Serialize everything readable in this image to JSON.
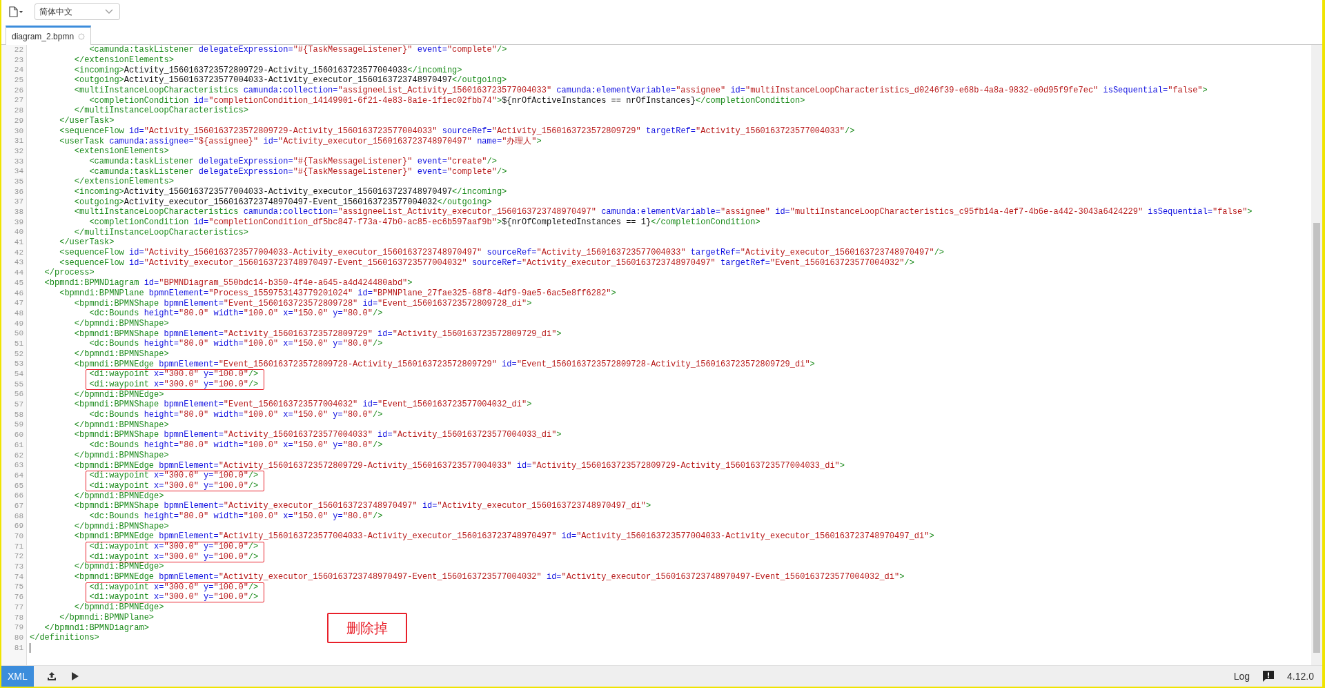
{
  "toolbar": {
    "language_select": {
      "value": "简体中文"
    }
  },
  "tabs": [
    {
      "label": "diagram_2.bpmn",
      "selected": true
    }
  ],
  "editor": {
    "lines": [
      {
        "number": "22",
        "marked": false,
        "cursor": false,
        "tokens": [
          {
            "kind": "tag",
            "text": "            <camunda:taskListener "
          },
          {
            "kind": "attr",
            "text": "delegateExpression="
          },
          {
            "kind": "value",
            "text": "\"#{TaskMessageListener}\""
          },
          {
            "kind": "attr",
            "text": " event="
          },
          {
            "kind": "value",
            "text": "\"complete\""
          },
          {
            "kind": "tag",
            "text": "/>"
          }
        ]
      },
      {
        "number": "23",
        "marked": false,
        "cursor": false,
        "tokens": [
          {
            "kind": "tag",
            "text": "         </extensionElements>"
          }
        ]
      },
      {
        "number": "24",
        "marked": false,
        "cursor": false,
        "tokens": [
          {
            "kind": "tag",
            "text": "         <incoming>"
          },
          {
            "kind": "text",
            "text": "Activity_1560163723572809729-Activity_1560163723577004033"
          },
          {
            "kind": "tag",
            "text": "</incoming>"
          }
        ]
      },
      {
        "number": "25",
        "marked": false,
        "cursor": false,
        "tokens": [
          {
            "kind": "tag",
            "text": "         <outgoing>"
          },
          {
            "kind": "text",
            "text": "Activity_1560163723577004033-Activity_executor_1560163723748970497"
          },
          {
            "kind": "tag",
            "text": "</outgoing>"
          }
        ]
      },
      {
        "number": "26",
        "marked": false,
        "cursor": false,
        "tokens": [
          {
            "kind": "tag",
            "text": "         <multiInstanceLoopCharacteristics "
          },
          {
            "kind": "attr",
            "text": "camunda:collection="
          },
          {
            "kind": "value",
            "text": "\"assigneeList_Activity_1560163723577004033\""
          },
          {
            "kind": "attr",
            "text": " camunda:elementVariable="
          },
          {
            "kind": "value",
            "text": "\"assignee\""
          },
          {
            "kind": "attr",
            "text": " id="
          },
          {
            "kind": "value",
            "text": "\"multiInstanceLoopCharacteristics_d0246f39-e68b-4a8a-9832-e0d95f9fe7ec\""
          },
          {
            "kind": "attr",
            "text": " isSequential="
          },
          {
            "kind": "value",
            "text": "\"false\""
          },
          {
            "kind": "tag",
            "text": ">"
          }
        ]
      },
      {
        "number": "27",
        "marked": false,
        "cursor": false,
        "tokens": [
          {
            "kind": "tag",
            "text": "            <completionCondition "
          },
          {
            "kind": "attr",
            "text": "id="
          },
          {
            "kind": "value",
            "text": "\"completionCondition_14149901-6f21-4e83-8a1e-1f1ec02fbb74\""
          },
          {
            "kind": "tag",
            "text": ">"
          },
          {
            "kind": "text",
            "text": "${nrOfActiveInstances == nrOfInstances}"
          },
          {
            "kind": "tag",
            "text": "</completionCondition>"
          }
        ]
      },
      {
        "number": "28",
        "marked": false,
        "cursor": false,
        "tokens": [
          {
            "kind": "tag",
            "text": "         </multiInstanceLoopCharacteristics>"
          }
        ]
      },
      {
        "number": "29",
        "marked": false,
        "cursor": false,
        "tokens": [
          {
            "kind": "tag",
            "text": "      </userTask>"
          }
        ]
      },
      {
        "number": "30",
        "marked": false,
        "cursor": false,
        "tokens": [
          {
            "kind": "tag",
            "text": "      <sequenceFlow "
          },
          {
            "kind": "attr",
            "text": "id="
          },
          {
            "kind": "value",
            "text": "\"Activity_1560163723572809729-Activity_1560163723577004033\""
          },
          {
            "kind": "attr",
            "text": " sourceRef="
          },
          {
            "kind": "value",
            "text": "\"Activity_1560163723572809729\""
          },
          {
            "kind": "attr",
            "text": " targetRef="
          },
          {
            "kind": "value",
            "text": "\"Activity_1560163723577004033\""
          },
          {
            "kind": "tag",
            "text": "/>"
          }
        ]
      },
      {
        "number": "31",
        "marked": false,
        "cursor": false,
        "tokens": [
          {
            "kind": "tag",
            "text": "      <userTask "
          },
          {
            "kind": "attr",
            "text": "camunda:assignee="
          },
          {
            "kind": "value",
            "text": "\"${assignee}\""
          },
          {
            "kind": "attr",
            "text": " id="
          },
          {
            "kind": "value",
            "text": "\"Activity_executor_1560163723748970497\""
          },
          {
            "kind": "attr",
            "text": " name="
          },
          {
            "kind": "value",
            "text": "\"办理人\""
          },
          {
            "kind": "tag",
            "text": ">"
          }
        ]
      },
      {
        "number": "32",
        "marked": false,
        "cursor": false,
        "tokens": [
          {
            "kind": "tag",
            "text": "         <extensionElements>"
          }
        ]
      },
      {
        "number": "33",
        "marked": false,
        "cursor": false,
        "tokens": [
          {
            "kind": "tag",
            "text": "            <camunda:taskListener "
          },
          {
            "kind": "attr",
            "text": "delegateExpression="
          },
          {
            "kind": "value",
            "text": "\"#{TaskMessageListener}\""
          },
          {
            "kind": "attr",
            "text": " event="
          },
          {
            "kind": "value",
            "text": "\"create\""
          },
          {
            "kind": "tag",
            "text": "/>"
          }
        ]
      },
      {
        "number": "34",
        "marked": false,
        "cursor": false,
        "tokens": [
          {
            "kind": "tag",
            "text": "            <camunda:taskListener "
          },
          {
            "kind": "attr",
            "text": "delegateExpression="
          },
          {
            "kind": "value",
            "text": "\"#{TaskMessageListener}\""
          },
          {
            "kind": "attr",
            "text": " event="
          },
          {
            "kind": "value",
            "text": "\"complete\""
          },
          {
            "kind": "tag",
            "text": "/>"
          }
        ]
      },
      {
        "number": "35",
        "marked": false,
        "cursor": false,
        "tokens": [
          {
            "kind": "tag",
            "text": "         </extensionElements>"
          }
        ]
      },
      {
        "number": "36",
        "marked": false,
        "cursor": false,
        "tokens": [
          {
            "kind": "tag",
            "text": "         <incoming>"
          },
          {
            "kind": "text",
            "text": "Activity_1560163723577004033-Activity_executor_1560163723748970497"
          },
          {
            "kind": "tag",
            "text": "</incoming>"
          }
        ]
      },
      {
        "number": "37",
        "marked": false,
        "cursor": false,
        "tokens": [
          {
            "kind": "tag",
            "text": "         <outgoing>"
          },
          {
            "kind": "text",
            "text": "Activity_executor_1560163723748970497-Event_1560163723577004032"
          },
          {
            "kind": "tag",
            "text": "</outgoing>"
          }
        ]
      },
      {
        "number": "38",
        "marked": false,
        "cursor": false,
        "tokens": [
          {
            "kind": "tag",
            "text": "         <multiInstanceLoopCharacteristics "
          },
          {
            "kind": "attr",
            "text": "camunda:collection="
          },
          {
            "kind": "value",
            "text": "\"assigneeList_Activity_executor_1560163723748970497\""
          },
          {
            "kind": "attr",
            "text": " camunda:elementVariable="
          },
          {
            "kind": "value",
            "text": "\"assignee\""
          },
          {
            "kind": "attr",
            "text": " id="
          },
          {
            "kind": "value",
            "text": "\"multiInstanceLoopCharacteristics_c95fb14a-4ef7-4b6e-a442-3043a6424229\""
          },
          {
            "kind": "attr",
            "text": " isSequential="
          },
          {
            "kind": "value",
            "text": "\"false\""
          },
          {
            "kind": "tag",
            "text": ">"
          }
        ]
      },
      {
        "number": "39",
        "marked": false,
        "cursor": false,
        "tokens": [
          {
            "kind": "tag",
            "text": "            <completionCondition "
          },
          {
            "kind": "attr",
            "text": "id="
          },
          {
            "kind": "value",
            "text": "\"completionCondition_df5bc847-f73a-47b0-ac85-ec6b597aaf9b\""
          },
          {
            "kind": "tag",
            "text": ">"
          },
          {
            "kind": "text",
            "text": "${nrOfCompletedInstances == 1}"
          },
          {
            "kind": "tag",
            "text": "</completionCondition>"
          }
        ]
      },
      {
        "number": "40",
        "marked": false,
        "cursor": false,
        "tokens": [
          {
            "kind": "tag",
            "text": "         </multiInstanceLoopCharacteristics>"
          }
        ]
      },
      {
        "number": "41",
        "marked": false,
        "cursor": false,
        "tokens": [
          {
            "kind": "tag",
            "text": "      </userTask>"
          }
        ]
      },
      {
        "number": "42",
        "marked": false,
        "cursor": false,
        "tokens": [
          {
            "kind": "tag",
            "text": "      <sequenceFlow "
          },
          {
            "kind": "attr",
            "text": "id="
          },
          {
            "kind": "value",
            "text": "\"Activity_1560163723577004033-Activity_executor_1560163723748970497\""
          },
          {
            "kind": "attr",
            "text": " sourceRef="
          },
          {
            "kind": "value",
            "text": "\"Activity_1560163723577004033\""
          },
          {
            "kind": "attr",
            "text": " targetRef="
          },
          {
            "kind": "value",
            "text": "\"Activity_executor_1560163723748970497\""
          },
          {
            "kind": "tag",
            "text": "/>"
          }
        ]
      },
      {
        "number": "43",
        "marked": false,
        "cursor": false,
        "tokens": [
          {
            "kind": "tag",
            "text": "      <sequenceFlow "
          },
          {
            "kind": "attr",
            "text": "id="
          },
          {
            "kind": "value",
            "text": "\"Activity_executor_1560163723748970497-Event_1560163723577004032\""
          },
          {
            "kind": "attr",
            "text": " sourceRef="
          },
          {
            "kind": "value",
            "text": "\"Activity_executor_1560163723748970497\""
          },
          {
            "kind": "attr",
            "text": " targetRef="
          },
          {
            "kind": "value",
            "text": "\"Event_1560163723577004032\""
          },
          {
            "kind": "tag",
            "text": "/>"
          }
        ]
      },
      {
        "number": "44",
        "marked": false,
        "cursor": false,
        "tokens": [
          {
            "kind": "tag",
            "text": "   </process>"
          }
        ]
      },
      {
        "number": "45",
        "marked": false,
        "cursor": false,
        "tokens": [
          {
            "kind": "tag",
            "text": "   <bpmndi:BPMNDiagram "
          },
          {
            "kind": "attr",
            "text": "id="
          },
          {
            "kind": "value",
            "text": "\"BPMNDiagram_550bdc14-b350-4f4e-a645-a4d424480abd\""
          },
          {
            "kind": "tag",
            "text": ">"
          }
        ]
      },
      {
        "number": "46",
        "marked": false,
        "cursor": false,
        "tokens": [
          {
            "kind": "tag",
            "text": "      <bpmndi:BPMNPlane "
          },
          {
            "kind": "attr",
            "text": "bpmnElement="
          },
          {
            "kind": "value",
            "text": "\"Process_1559753143779201024\""
          },
          {
            "kind": "attr",
            "text": " id="
          },
          {
            "kind": "value",
            "text": "\"BPMNPlane_27fae325-68f8-4df9-9ae5-6ac5e8ff6282\""
          },
          {
            "kind": "tag",
            "text": ">"
          }
        ]
      },
      {
        "number": "47",
        "marked": false,
        "cursor": false,
        "tokens": [
          {
            "kind": "tag",
            "text": "         <bpmndi:BPMNShape "
          },
          {
            "kind": "attr",
            "text": "bpmnElement="
          },
          {
            "kind": "value",
            "text": "\"Event_1560163723572809728\""
          },
          {
            "kind": "attr",
            "text": " id="
          },
          {
            "kind": "value",
            "text": "\"Event_1560163723572809728_di\""
          },
          {
            "kind": "tag",
            "text": ">"
          }
        ]
      },
      {
        "number": "48",
        "marked": false,
        "cursor": false,
        "tokens": [
          {
            "kind": "tag",
            "text": "            <dc:Bounds "
          },
          {
            "kind": "attr",
            "text": "height="
          },
          {
            "kind": "value",
            "text": "\"80.0\""
          },
          {
            "kind": "attr",
            "text": " width="
          },
          {
            "kind": "value",
            "text": "\"100.0\""
          },
          {
            "kind": "attr",
            "text": " x="
          },
          {
            "kind": "value",
            "text": "\"150.0\""
          },
          {
            "kind": "attr",
            "text": " y="
          },
          {
            "kind": "value",
            "text": "\"80.0\""
          },
          {
            "kind": "tag",
            "text": "/>"
          }
        ]
      },
      {
        "number": "49",
        "marked": false,
        "cursor": false,
        "tokens": [
          {
            "kind": "tag",
            "text": "         </bpmndi:BPMNShape>"
          }
        ]
      },
      {
        "number": "50",
        "marked": false,
        "cursor": false,
        "tokens": [
          {
            "kind": "tag",
            "text": "         <bpmndi:BPMNShape "
          },
          {
            "kind": "attr",
            "text": "bpmnElement="
          },
          {
            "kind": "value",
            "text": "\"Activity_1560163723572809729\""
          },
          {
            "kind": "attr",
            "text": " id="
          },
          {
            "kind": "value",
            "text": "\"Activity_1560163723572809729_di\""
          },
          {
            "kind": "tag",
            "text": ">"
          }
        ]
      },
      {
        "number": "51",
        "marked": false,
        "cursor": false,
        "tokens": [
          {
            "kind": "tag",
            "text": "            <dc:Bounds "
          },
          {
            "kind": "attr",
            "text": "height="
          },
          {
            "kind": "value",
            "text": "\"80.0\""
          },
          {
            "kind": "attr",
            "text": " width="
          },
          {
            "kind": "value",
            "text": "\"100.0\""
          },
          {
            "kind": "attr",
            "text": " x="
          },
          {
            "kind": "value",
            "text": "\"150.0\""
          },
          {
            "kind": "attr",
            "text": " y="
          },
          {
            "kind": "value",
            "text": "\"80.0\""
          },
          {
            "kind": "tag",
            "text": "/>"
          }
        ]
      },
      {
        "number": "52",
        "marked": false,
        "cursor": false,
        "tokens": [
          {
            "kind": "tag",
            "text": "         </bpmndi:BPMNShape>"
          }
        ]
      },
      {
        "number": "53",
        "marked": false,
        "cursor": false,
        "tokens": [
          {
            "kind": "tag",
            "text": "         <bpmndi:BPMNEdge "
          },
          {
            "kind": "attr",
            "text": "bpmnElement="
          },
          {
            "kind": "value",
            "text": "\"Event_1560163723572809728-Activity_1560163723572809729\""
          },
          {
            "kind": "attr",
            "text": " id="
          },
          {
            "kind": "value",
            "text": "\"Event_1560163723572809728-Activity_1560163723572809729_di\""
          },
          {
            "kind": "tag",
            "text": ">"
          }
        ]
      },
      {
        "number": "54",
        "marked": true,
        "cursor": false,
        "tokens": [
          {
            "kind": "tag",
            "text": "            <di:waypoint "
          },
          {
            "kind": "attr",
            "text": "x="
          },
          {
            "kind": "value",
            "text": "\"300.0\""
          },
          {
            "kind": "attr",
            "text": " y="
          },
          {
            "kind": "value",
            "text": "\"100.0\""
          },
          {
            "kind": "tag",
            "text": "/>"
          }
        ]
      },
      {
        "number": "55",
        "marked": true,
        "cursor": false,
        "tokens": [
          {
            "kind": "tag",
            "text": "            <di:waypoint "
          },
          {
            "kind": "attr",
            "text": "x="
          },
          {
            "kind": "value",
            "text": "\"300.0\""
          },
          {
            "kind": "attr",
            "text": " y="
          },
          {
            "kind": "value",
            "text": "\"100.0\""
          },
          {
            "kind": "tag",
            "text": "/>"
          }
        ]
      },
      {
        "number": "56",
        "marked": false,
        "cursor": false,
        "tokens": [
          {
            "kind": "tag",
            "text": "         </bpmndi:BPMNEdge>"
          }
        ]
      },
      {
        "number": "57",
        "marked": false,
        "cursor": false,
        "tokens": [
          {
            "kind": "tag",
            "text": "         <bpmndi:BPMNShape "
          },
          {
            "kind": "attr",
            "text": "bpmnElement="
          },
          {
            "kind": "value",
            "text": "\"Event_1560163723577004032\""
          },
          {
            "kind": "attr",
            "text": " id="
          },
          {
            "kind": "value",
            "text": "\"Event_1560163723577004032_di\""
          },
          {
            "kind": "tag",
            "text": ">"
          }
        ]
      },
      {
        "number": "58",
        "marked": false,
        "cursor": false,
        "tokens": [
          {
            "kind": "tag",
            "text": "            <dc:Bounds "
          },
          {
            "kind": "attr",
            "text": "height="
          },
          {
            "kind": "value",
            "text": "\"80.0\""
          },
          {
            "kind": "attr",
            "text": " width="
          },
          {
            "kind": "value",
            "text": "\"100.0\""
          },
          {
            "kind": "attr",
            "text": " x="
          },
          {
            "kind": "value",
            "text": "\"150.0\""
          },
          {
            "kind": "attr",
            "text": " y="
          },
          {
            "kind": "value",
            "text": "\"80.0\""
          },
          {
            "kind": "tag",
            "text": "/>"
          }
        ]
      },
      {
        "number": "59",
        "marked": false,
        "cursor": false,
        "tokens": [
          {
            "kind": "tag",
            "text": "         </bpmndi:BPMNShape>"
          }
        ]
      },
      {
        "number": "60",
        "marked": false,
        "cursor": false,
        "tokens": [
          {
            "kind": "tag",
            "text": "         <bpmndi:BPMNShape "
          },
          {
            "kind": "attr",
            "text": "bpmnElement="
          },
          {
            "kind": "value",
            "text": "\"Activity_1560163723577004033\""
          },
          {
            "kind": "attr",
            "text": " id="
          },
          {
            "kind": "value",
            "text": "\"Activity_1560163723577004033_di\""
          },
          {
            "kind": "tag",
            "text": ">"
          }
        ]
      },
      {
        "number": "61",
        "marked": false,
        "cursor": false,
        "tokens": [
          {
            "kind": "tag",
            "text": "            <dc:Bounds "
          },
          {
            "kind": "attr",
            "text": "height="
          },
          {
            "kind": "value",
            "text": "\"80.0\""
          },
          {
            "kind": "attr",
            "text": " width="
          },
          {
            "kind": "value",
            "text": "\"100.0\""
          },
          {
            "kind": "attr",
            "text": " x="
          },
          {
            "kind": "value",
            "text": "\"150.0\""
          },
          {
            "kind": "attr",
            "text": " y="
          },
          {
            "kind": "value",
            "text": "\"80.0\""
          },
          {
            "kind": "tag",
            "text": "/>"
          }
        ]
      },
      {
        "number": "62",
        "marked": false,
        "cursor": false,
        "tokens": [
          {
            "kind": "tag",
            "text": "         </bpmndi:BPMNShape>"
          }
        ]
      },
      {
        "number": "63",
        "marked": false,
        "cursor": false,
        "tokens": [
          {
            "kind": "tag",
            "text": "         <bpmndi:BPMNEdge "
          },
          {
            "kind": "attr",
            "text": "bpmnElement="
          },
          {
            "kind": "value",
            "text": "\"Activity_1560163723572809729-Activity_1560163723577004033\""
          },
          {
            "kind": "attr",
            "text": " id="
          },
          {
            "kind": "value",
            "text": "\"Activity_1560163723572809729-Activity_1560163723577004033_di\""
          },
          {
            "kind": "tag",
            "text": ">"
          }
        ]
      },
      {
        "number": "64",
        "marked": true,
        "cursor": false,
        "tokens": [
          {
            "kind": "tag",
            "text": "            <di:waypoint "
          },
          {
            "kind": "attr",
            "text": "x="
          },
          {
            "kind": "value",
            "text": "\"300.0\""
          },
          {
            "kind": "attr",
            "text": " y="
          },
          {
            "kind": "value",
            "text": "\"100.0\""
          },
          {
            "kind": "tag",
            "text": "/>"
          }
        ]
      },
      {
        "number": "65",
        "marked": true,
        "cursor": false,
        "tokens": [
          {
            "kind": "tag",
            "text": "            <di:waypoint "
          },
          {
            "kind": "attr",
            "text": "x="
          },
          {
            "kind": "value",
            "text": "\"300.0\""
          },
          {
            "kind": "attr",
            "text": " y="
          },
          {
            "kind": "value",
            "text": "\"100.0\""
          },
          {
            "kind": "tag",
            "text": "/>"
          }
        ]
      },
      {
        "number": "66",
        "marked": false,
        "cursor": false,
        "tokens": [
          {
            "kind": "tag",
            "text": "         </bpmndi:BPMNEdge>"
          }
        ]
      },
      {
        "number": "67",
        "marked": false,
        "cursor": false,
        "tokens": [
          {
            "kind": "tag",
            "text": "         <bpmndi:BPMNShape "
          },
          {
            "kind": "attr",
            "text": "bpmnElement="
          },
          {
            "kind": "value",
            "text": "\"Activity_executor_1560163723748970497\""
          },
          {
            "kind": "attr",
            "text": " id="
          },
          {
            "kind": "value",
            "text": "\"Activity_executor_1560163723748970497_di\""
          },
          {
            "kind": "tag",
            "text": ">"
          }
        ]
      },
      {
        "number": "68",
        "marked": false,
        "cursor": false,
        "tokens": [
          {
            "kind": "tag",
            "text": "            <dc:Bounds "
          },
          {
            "kind": "attr",
            "text": "height="
          },
          {
            "kind": "value",
            "text": "\"80.0\""
          },
          {
            "kind": "attr",
            "text": " width="
          },
          {
            "kind": "value",
            "text": "\"100.0\""
          },
          {
            "kind": "attr",
            "text": " x="
          },
          {
            "kind": "value",
            "text": "\"150.0\""
          },
          {
            "kind": "attr",
            "text": " y="
          },
          {
            "kind": "value",
            "text": "\"80.0\""
          },
          {
            "kind": "tag",
            "text": "/>"
          }
        ]
      },
      {
        "number": "69",
        "marked": false,
        "cursor": false,
        "tokens": [
          {
            "kind": "tag",
            "text": "         </bpmndi:BPMNShape>"
          }
        ]
      },
      {
        "number": "70",
        "marked": false,
        "cursor": false,
        "tokens": [
          {
            "kind": "tag",
            "text": "         <bpmndi:BPMNEdge "
          },
          {
            "kind": "attr",
            "text": "bpmnElement="
          },
          {
            "kind": "value",
            "text": "\"Activity_1560163723577004033-Activity_executor_1560163723748970497\""
          },
          {
            "kind": "attr",
            "text": " id="
          },
          {
            "kind": "value",
            "text": "\"Activity_1560163723577004033-Activity_executor_1560163723748970497_di\""
          },
          {
            "kind": "tag",
            "text": ">"
          }
        ]
      },
      {
        "number": "71",
        "marked": true,
        "cursor": false,
        "tokens": [
          {
            "kind": "tag",
            "text": "            <di:waypoint "
          },
          {
            "kind": "attr",
            "text": "x="
          },
          {
            "kind": "value",
            "text": "\"300.0\""
          },
          {
            "kind": "attr",
            "text": " y="
          },
          {
            "kind": "value",
            "text": "\"100.0\""
          },
          {
            "kind": "tag",
            "text": "/>"
          }
        ]
      },
      {
        "number": "72",
        "marked": true,
        "cursor": false,
        "tokens": [
          {
            "kind": "tag",
            "text": "            <di:waypoint "
          },
          {
            "kind": "attr",
            "text": "x="
          },
          {
            "kind": "value",
            "text": "\"300.0\""
          },
          {
            "kind": "attr",
            "text": " y="
          },
          {
            "kind": "value",
            "text": "\"100.0\""
          },
          {
            "kind": "tag",
            "text": "/>"
          }
        ]
      },
      {
        "number": "73",
        "marked": false,
        "cursor": false,
        "tokens": [
          {
            "kind": "tag",
            "text": "         </bpmndi:BPMNEdge>"
          }
        ]
      },
      {
        "number": "74",
        "marked": false,
        "cursor": false,
        "tokens": [
          {
            "kind": "tag",
            "text": "         <bpmndi:BPMNEdge "
          },
          {
            "kind": "attr",
            "text": "bpmnElement="
          },
          {
            "kind": "value",
            "text": "\"Activity_executor_1560163723748970497-Event_1560163723577004032\""
          },
          {
            "kind": "attr",
            "text": " id="
          },
          {
            "kind": "value",
            "text": "\"Activity_executor_1560163723748970497-Event_1560163723577004032_di\""
          },
          {
            "kind": "tag",
            "text": ">"
          }
        ]
      },
      {
        "number": "75",
        "marked": true,
        "cursor": false,
        "tokens": [
          {
            "kind": "tag",
            "text": "            <di:waypoint "
          },
          {
            "kind": "attr",
            "text": "x="
          },
          {
            "kind": "value",
            "text": "\"300.0\""
          },
          {
            "kind": "attr",
            "text": " y="
          },
          {
            "kind": "value",
            "text": "\"100.0\""
          },
          {
            "kind": "tag",
            "text": "/>"
          }
        ]
      },
      {
        "number": "76",
        "marked": true,
        "cursor": false,
        "tokens": [
          {
            "kind": "tag",
            "text": "            <di:waypoint "
          },
          {
            "kind": "attr",
            "text": "x="
          },
          {
            "kind": "value",
            "text": "\"300.0\""
          },
          {
            "kind": "attr",
            "text": " y="
          },
          {
            "kind": "value",
            "text": "\"100.0\""
          },
          {
            "kind": "tag",
            "text": "/>"
          }
        ]
      },
      {
        "number": "77",
        "marked": false,
        "cursor": false,
        "tokens": [
          {
            "kind": "tag",
            "text": "         </bpmndi:BPMNEdge>"
          }
        ]
      },
      {
        "number": "78",
        "marked": false,
        "cursor": false,
        "tokens": [
          {
            "kind": "tag",
            "text": "      </bpmndi:BPMNPlane>"
          }
        ]
      },
      {
        "number": "79",
        "marked": false,
        "cursor": false,
        "tokens": [
          {
            "kind": "tag",
            "text": "   </bpmndi:BPMNDiagram>"
          }
        ]
      },
      {
        "number": "80",
        "marked": false,
        "cursor": false,
        "tokens": [
          {
            "kind": "tag",
            "text": "</definitions>"
          }
        ]
      },
      {
        "number": "81",
        "marked": false,
        "cursor": true
      }
    ],
    "callout": {
      "text": "删除掉"
    }
  },
  "status_bar": {
    "mode_tabs": [
      {
        "label": "XML",
        "selected": true
      }
    ],
    "log": "Log",
    "version": "4.12.0"
  }
}
